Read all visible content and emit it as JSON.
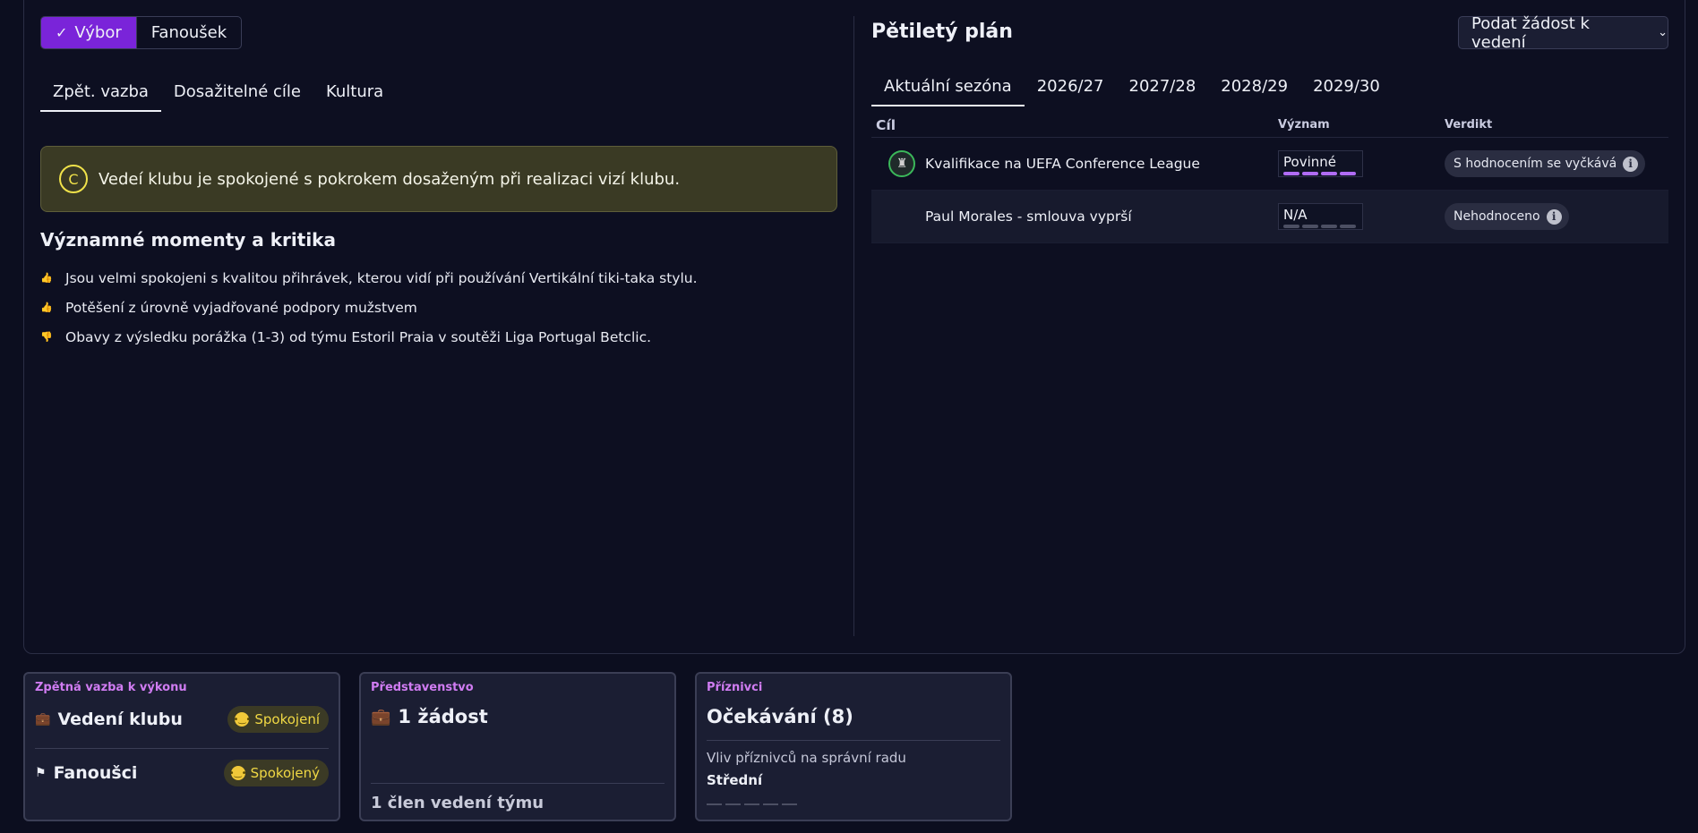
{
  "toggle": {
    "committee": "Výbor",
    "fan": "Fanoušek"
  },
  "left_tabs": [
    "Zpět. vazba",
    "Dosažitelné cíle",
    "Kultura"
  ],
  "banner": {
    "grade": "C",
    "text": "Vedeí klubu je spokojené s pokrokem dosaženým při realizaci vizí klubu.",
    "color": "#3a3a24"
  },
  "moments": {
    "title": "Významné momenty a kritika",
    "items": [
      {
        "type": "positive",
        "text": "Jsou velmi spokojeni s kvalitou přihrávek, kterou vidí při používání Vertikální tiki-taka stylu."
      },
      {
        "type": "positive",
        "text": "Potěšení z úrovně vyjadřované podpory mužstvem"
      },
      {
        "type": "negative",
        "text": "Obavy z výsledku porážka (1-3) od týmu Estoril Praia v soutěži Liga Portugal Betclic."
      }
    ]
  },
  "plan": {
    "title": "Pětiletý plán",
    "request_button": "Podat žádost k vedení",
    "tabs": [
      "Aktuální sezóna",
      "2026/27",
      "2027/28",
      "2028/29",
      "2029/30"
    ],
    "columns": [
      "Cíl",
      "Význam",
      "Verdikt"
    ],
    "rows": [
      {
        "goal": "Kvalifikace na UEFA Conference League",
        "importance": "Povinné",
        "importance_level": 4,
        "verdict": "S hodnocením se vyčkává",
        "icon": "trophy-icon"
      },
      {
        "goal": "Paul Morales - smlouva vyprší",
        "importance": "N/A",
        "importance_level": 0,
        "verdict": "Nehodnoceno",
        "icon": ""
      }
    ]
  },
  "cards": {
    "performance": {
      "label": "Zpětná vazba k výkonu",
      "board_label": "Vedení klubu",
      "board_mood": "Spokojení",
      "fans_label": "Fanoušci",
      "fans_mood": "Spokojený"
    },
    "board": {
      "label": "Představenstvo",
      "requests": "1 žádost",
      "members": "1 člen vedení týmu"
    },
    "supporters": {
      "label": "Příznivci",
      "expectations": "Očekávání (8)",
      "influence_label": "Vliv příznivců na správní radu",
      "influence_value": "Střední"
    }
  },
  "accent_colors": {
    "primary": "#7a24d9",
    "importance_bar": "#b06cf4",
    "label": "#d07cf2",
    "positive": "#3ecf5a",
    "negative": "#f0506a",
    "mood": "#f0d844"
  }
}
